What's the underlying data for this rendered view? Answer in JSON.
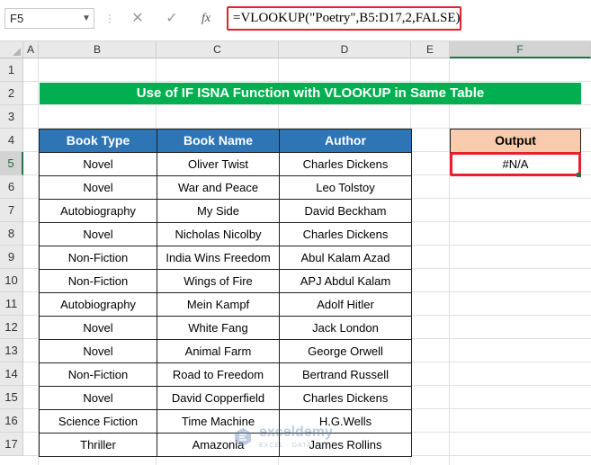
{
  "formula_bar": {
    "name_box": "F5",
    "cancel_icon": "✕",
    "enter_icon": "✓",
    "function_icon": "fx",
    "formula": "=VLOOKUP(\"Poetry\",B5:D17,2,FALSE)"
  },
  "columns": [
    "A",
    "B",
    "C",
    "D",
    "E",
    "F"
  ],
  "selected_column": "F",
  "rows": [
    "1",
    "2",
    "3",
    "4",
    "5",
    "6",
    "7",
    "8",
    "9",
    "10",
    "11",
    "12",
    "13",
    "14",
    "15",
    "16",
    "17"
  ],
  "selected_row": "5",
  "title": "Use of IF ISNA Function with VLOOKUP in Same Table",
  "table": {
    "headers": [
      "Book Type",
      "Book Name",
      "Author"
    ],
    "rows": [
      [
        "Novel",
        "Oliver Twist",
        "Charles Dickens"
      ],
      [
        "Novel",
        "War and Peace",
        "Leo Tolstoy"
      ],
      [
        "Autobiography",
        "My Side",
        "David Beckham"
      ],
      [
        "Novel",
        "Nicholas Nicolby",
        "Charles Dickens"
      ],
      [
        "Non-Fiction",
        "India Wins Freedom",
        "Abul Kalam Azad"
      ],
      [
        "Non-Fiction",
        "Wings of Fire",
        "APJ Abdul Kalam"
      ],
      [
        "Autobiography",
        "Mein Kampf",
        "Adolf Hitler"
      ],
      [
        "Novel",
        "White Fang",
        "Jack London"
      ],
      [
        "Novel",
        "Animal Farm",
        "George Orwell"
      ],
      [
        "Non-Fiction",
        "Road to Freedom",
        "Bertrand Russell"
      ],
      [
        "Novel",
        "David Copperfield",
        "Charles Dickens"
      ],
      [
        "Science Fiction",
        "Time Machine",
        "H.G.Wells"
      ],
      [
        "Thriller",
        "Amazonia",
        "James Rollins"
      ]
    ]
  },
  "output": {
    "header": "Output",
    "value": "#N/A"
  },
  "watermark": {
    "name": "exceldemy",
    "tagline": "EXCEL · DATA · BI"
  },
  "colors": {
    "title_bg": "#00b050",
    "table_header_bg": "#2e75b6",
    "output_header_bg": "#f8cbad",
    "highlight_border": "#e5212a",
    "selection_green": "#217346"
  }
}
